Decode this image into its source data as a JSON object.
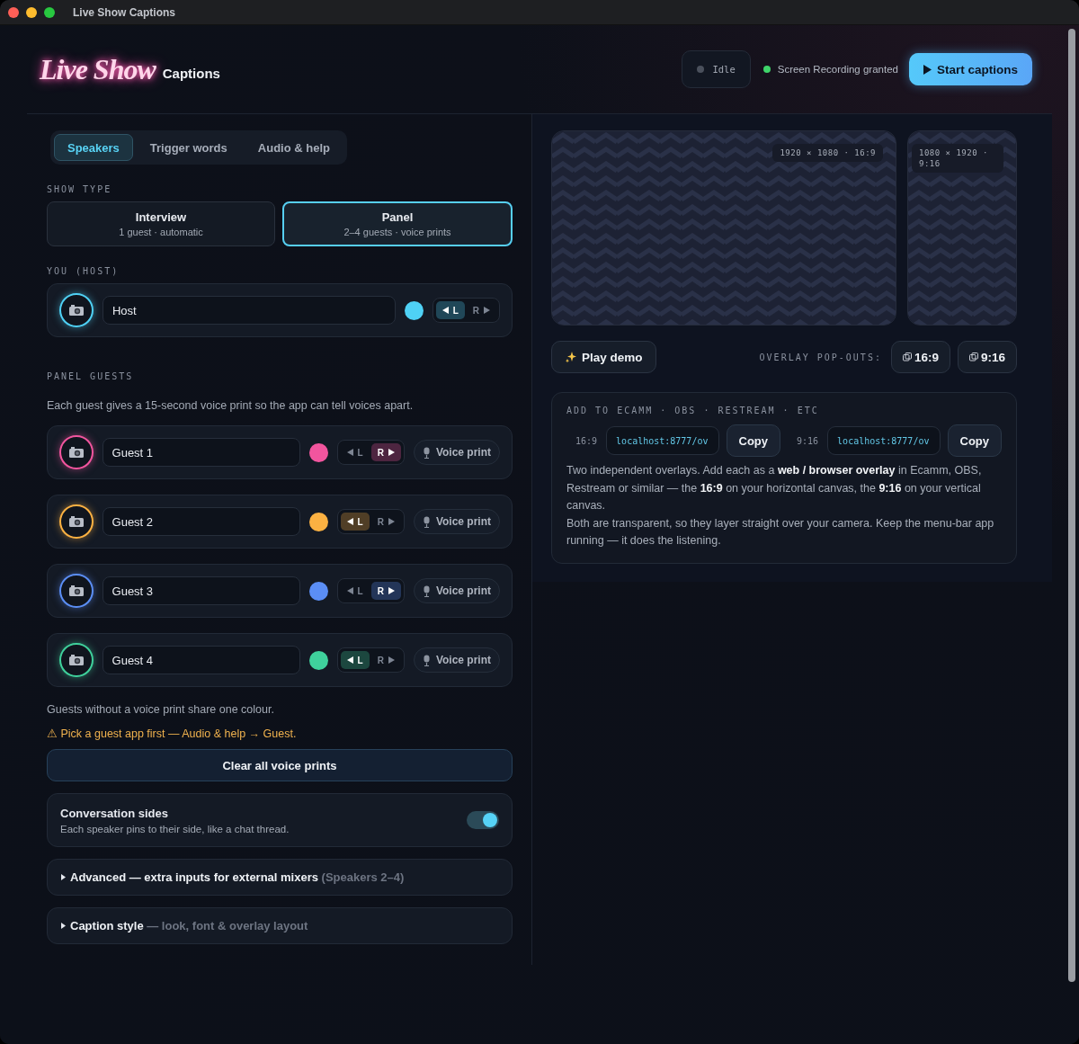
{
  "window": {
    "title": "Live Show Captions"
  },
  "header": {
    "logo_script": "Live Show",
    "logo_text": "Captions",
    "status": {
      "label": "Idle"
    },
    "permission": {
      "label": "Screen Recording granted",
      "granted": true
    },
    "start_button": "Start captions"
  },
  "tabs": [
    {
      "label": "Speakers",
      "selected": true
    },
    {
      "label": "Trigger words",
      "selected": false
    },
    {
      "label": "Audio & help",
      "selected": false
    }
  ],
  "show_type": {
    "label": "SHOW TYPE",
    "options": [
      {
        "title": "Interview",
        "subtitle": "1 guest · automatic",
        "selected": false
      },
      {
        "title": "Panel",
        "subtitle": "2–4 guests · voice prints",
        "selected": true
      }
    ]
  },
  "host": {
    "label": "YOU (HOST)",
    "name": "Host",
    "color": "#4fd1f5",
    "sides": [
      {
        "label": "L",
        "selected": true
      },
      {
        "label": "R",
        "selected": false
      }
    ]
  },
  "guests": {
    "label": "PANEL GUESTS",
    "description": "Each guest gives a 15-second voice print so the app can tell voices apart.",
    "items": [
      {
        "name": "Guest 1",
        "color": "#f2559e",
        "sides": [
          {
            "label": "L",
            "selected": false
          },
          {
            "label": "R",
            "selected": true
          }
        ],
        "voice_print": "Voice print"
      },
      {
        "name": "Guest 2",
        "color": "#fbb142",
        "sides": [
          {
            "label": "L",
            "selected": true
          },
          {
            "label": "R",
            "selected": false
          }
        ],
        "voice_print": "Voice print"
      },
      {
        "name": "Guest 3",
        "color": "#5b8ef5",
        "sides": [
          {
            "label": "L",
            "selected": false
          },
          {
            "label": "R",
            "selected": true
          }
        ],
        "voice_print": "Voice print"
      },
      {
        "name": "Guest 4",
        "color": "#3fd19c",
        "sides": [
          {
            "label": "L",
            "selected": true
          },
          {
            "label": "R",
            "selected": false
          }
        ],
        "voice_print": "Voice print"
      }
    ]
  },
  "note": "Guests without a voice print share one colour.",
  "warning": "⚠ Pick a guest app first — Audio & help → Guest.",
  "clear_button": "Clear all voice prints",
  "conversation_sides": {
    "title": "Conversation sides",
    "description": "Each speaker pins to their side, like a chat thread.",
    "on": true
  },
  "sections": [
    {
      "title": "Advanced — extra inputs for external mixers",
      "hint": "(Speakers 2–4)",
      "expanded": false
    },
    {
      "title": "Caption style",
      "hint": "— look, font & overlay layout",
      "expanded": false
    }
  ],
  "previews": [
    {
      "label": "1920 × 1080 · 16:9",
      "kind": "landscape"
    },
    {
      "label": "1080 × 1920 · 9:16",
      "kind": "portrait"
    }
  ],
  "play_demo": "Play demo",
  "popouts": {
    "label": "OVERLAY POP-OUTS:",
    "buttons": [
      "16:9",
      "9:16"
    ]
  },
  "embed": {
    "label": "ADD TO ECAMM · OBS · RESTREAM · ETC",
    "urls": [
      {
        "ratio": "16:9",
        "url": "localhost:8777/ov",
        "button": "Copy"
      },
      {
        "ratio": "9:16",
        "url": "localhost:8777/ov",
        "button": "Copy"
      }
    ],
    "paragraphs": [
      "Two independent overlays. Add each as a **web / browser overlay** in Ecamm, OBS, Restream or similar — the **16:9** on your horizontal canvas, the **9:16** on your vertical canvas.",
      "Both are transparent, so they layer straight over your camera. Keep the menu-bar app running — it does the listening."
    ]
  }
}
